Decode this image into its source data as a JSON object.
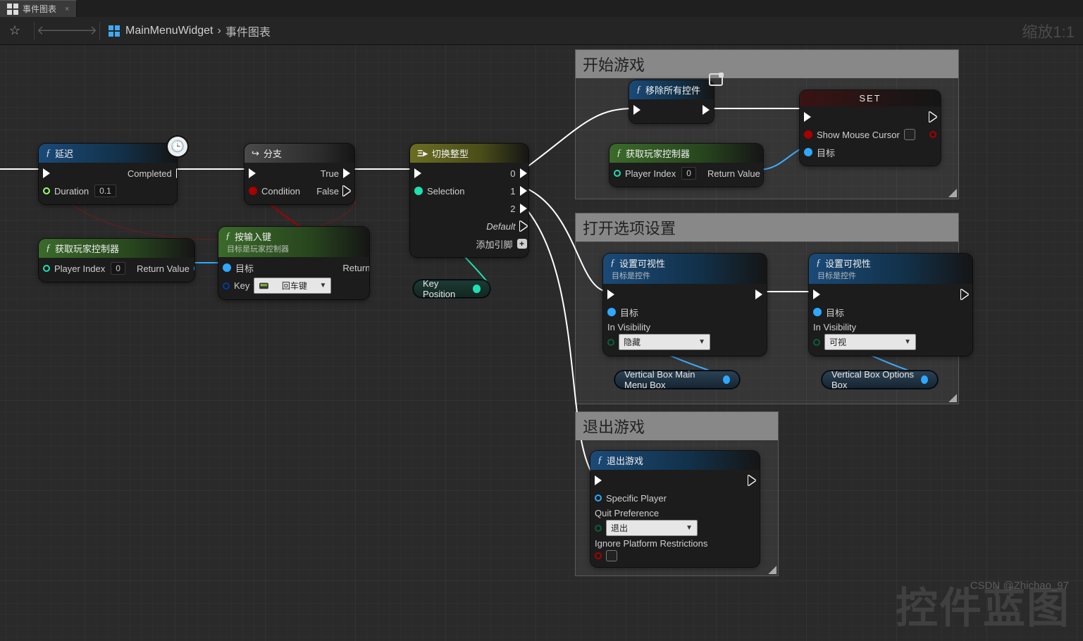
{
  "tab": {
    "title": "事件图表"
  },
  "breadcrumb": {
    "item1": "MainMenuWidget",
    "sep": "›",
    "item2": "事件图表"
  },
  "zoom": "缩放1:1",
  "watermark": {
    "big": "控件蓝图",
    "small": "CSDN @Zhichao_97"
  },
  "comments": {
    "c1": "开始游戏",
    "c2": "打开选项设置",
    "c3": "退出游戏"
  },
  "nodes": {
    "delay": {
      "title": "延迟",
      "duration_label": "Duration",
      "duration_value": "0.1",
      "completed": "Completed"
    },
    "branch": {
      "title": "分支",
      "condition": "Condition",
      "true": "True",
      "false": "False"
    },
    "keyinput": {
      "title": "按输入键",
      "subtitle": "目标是玩家控制器",
      "target": "目标",
      "key": "Key",
      "key_value": "回车键",
      "return": "Return Value"
    },
    "getpc1": {
      "title": "获取玩家控制器",
      "player_index": "Player Index",
      "player_index_value": "0",
      "return": "Return Value"
    },
    "getpc2": {
      "title": "获取玩家控制器",
      "player_index": "Player Index",
      "player_index_value": "0",
      "return": "Return Value"
    },
    "switch": {
      "title": "切换整型",
      "selection": "Selection",
      "out0": "0",
      "out1": "1",
      "out2": "2",
      "default": "Default",
      "addpin": "添加引脚"
    },
    "keypos": "Key Position",
    "removeall": {
      "title": "移除所有控件"
    },
    "set": {
      "title": "SET",
      "show_cursor": "Show Mouse Cursor",
      "target": "目标"
    },
    "setvis1": {
      "title": "设置可视性",
      "subtitle": "目标是控件",
      "target": "目标",
      "invis": "In Visibility",
      "combo_value": "隐藏"
    },
    "setvis2": {
      "title": "设置可视性",
      "subtitle": "目标是控件",
      "target": "目标",
      "invis": "In Visibility",
      "combo_value": "可视"
    },
    "vb1": "Vertical Box Main Menu Box",
    "vb2": "Vertical Box Options Box",
    "quit": {
      "title": "退出游戏",
      "specific": "Specific Player",
      "pref": "Quit Preference",
      "pref_value": "退出",
      "ignore": "Ignore Platform Restrictions"
    }
  }
}
